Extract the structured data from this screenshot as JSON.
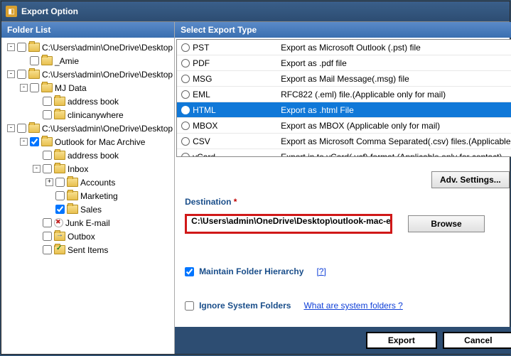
{
  "window": {
    "title": "Export Option"
  },
  "left": {
    "header": "Folder List"
  },
  "tree": [
    {
      "indent": 0,
      "exp": "-",
      "cb": false,
      "icon": "open",
      "label": "C:\\Users\\admin\\OneDrive\\Desktop"
    },
    {
      "indent": 1,
      "exp": "",
      "cb": false,
      "icon": "closed",
      "label": "_Amie"
    },
    {
      "indent": 0,
      "exp": "-",
      "cb": false,
      "icon": "open",
      "label": "C:\\Users\\admin\\OneDrive\\Desktop"
    },
    {
      "indent": 1,
      "exp": "-",
      "cb": false,
      "icon": "open",
      "label": "MJ Data"
    },
    {
      "indent": 2,
      "exp": "",
      "cb": false,
      "icon": "closed",
      "label": "address book"
    },
    {
      "indent": 2,
      "exp": "",
      "cb": false,
      "icon": "closed",
      "label": "clinicanywhere"
    },
    {
      "indent": 0,
      "exp": "-",
      "cb": false,
      "icon": "open",
      "label": "C:\\Users\\admin\\OneDrive\\Desktop"
    },
    {
      "indent": 1,
      "exp": "-",
      "cb": true,
      "icon": "open",
      "label": "Outlook for Mac Archive"
    },
    {
      "indent": 2,
      "exp": "",
      "cb": false,
      "icon": "closed",
      "label": "address book"
    },
    {
      "indent": 2,
      "exp": "-",
      "cb": false,
      "icon": "open",
      "label": "Inbox"
    },
    {
      "indent": 3,
      "exp": "+",
      "cb": false,
      "icon": "closed",
      "label": "Accounts"
    },
    {
      "indent": 3,
      "exp": "",
      "cb": false,
      "icon": "closed",
      "label": "Marketing"
    },
    {
      "indent": 3,
      "exp": "",
      "cb": true,
      "icon": "closed",
      "label": "Sales"
    },
    {
      "indent": 2,
      "exp": "",
      "cb": false,
      "icon": "junk",
      "label": "Junk E-mail"
    },
    {
      "indent": 2,
      "exp": "",
      "cb": false,
      "icon": "out",
      "label": "Outbox"
    },
    {
      "indent": 2,
      "exp": "",
      "cb": false,
      "icon": "sent",
      "label": "Sent Items"
    }
  ],
  "right": {
    "header": "Select Export Type"
  },
  "exports": [
    {
      "sel": false,
      "type": "PST",
      "desc": "Export as Microsoft Outlook (.pst) file"
    },
    {
      "sel": false,
      "type": "PDF",
      "desc": "Export as .pdf file"
    },
    {
      "sel": false,
      "type": "MSG",
      "desc": "Export as Mail Message(.msg) file"
    },
    {
      "sel": false,
      "type": "EML",
      "desc": "RFC822 (.eml) file.(Applicable only for mail)"
    },
    {
      "sel": true,
      "type": "HTML",
      "desc": "Export as .html File"
    },
    {
      "sel": false,
      "type": "MBOX",
      "desc": "Export as MBOX (Applicable only for mail)"
    },
    {
      "sel": false,
      "type": "CSV",
      "desc": "Export as Microsoft Comma Separated(.csv) files.(Applicable ..."
    },
    {
      "sel": false,
      "type": "vCard",
      "desc": "Export in to vCard(.vcf) format (Applicable only for contact)"
    }
  ],
  "buttons": {
    "adv": "Adv. Settings...",
    "browse": "Browse",
    "export": "Export",
    "cancel": "Cancel"
  },
  "dest": {
    "label": "Destination",
    "value": "C:\\Users\\admin\\OneDrive\\Desktop\\outlook-mac-expor"
  },
  "opts": {
    "maintain": "Maintain Folder Hierarchy",
    "maintain_checked": true,
    "help": "[?]",
    "ignore": "Ignore System Folders",
    "ignore_checked": false,
    "ignore_link": "What are system folders ?"
  }
}
